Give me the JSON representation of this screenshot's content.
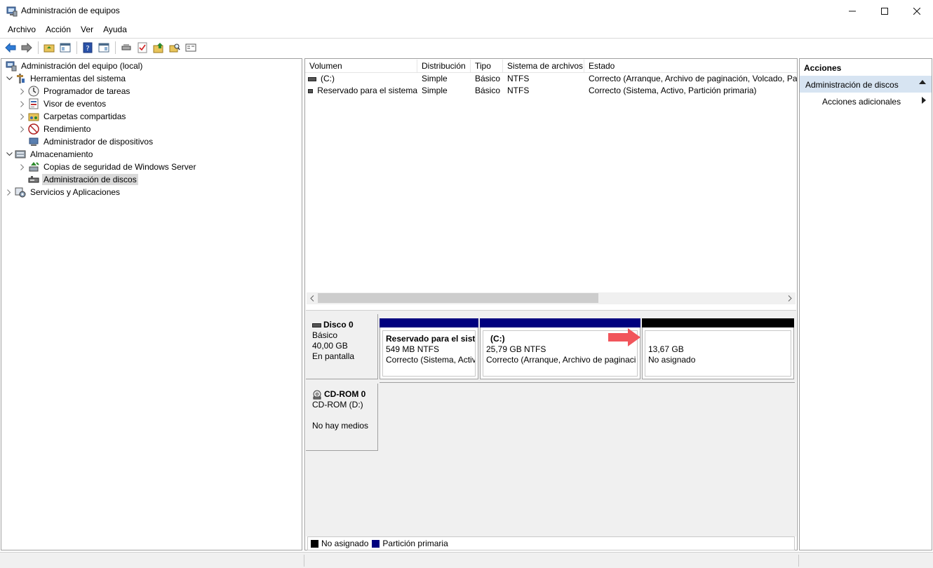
{
  "window": {
    "title": "Administración de equipos"
  },
  "menu": [
    "Archivo",
    "Acción",
    "Ver",
    "Ayuda"
  ],
  "tree": {
    "root": "Administración del equipo (local)",
    "system_tools": "Herramientas del sistema",
    "task_scheduler": "Programador de tareas",
    "event_viewer": "Visor de eventos",
    "shared_folders": "Carpetas compartidas",
    "performance": "Rendimiento",
    "device_manager": "Administrador de dispositivos",
    "storage": "Almacenamiento",
    "backup": "Copias de seguridad de Windows Server",
    "disk_management": "Administración de discos",
    "services_apps": "Servicios y Aplicaciones"
  },
  "volumes": {
    "headers": [
      "Volumen",
      "Distribución",
      "Tipo",
      "Sistema de archivos",
      "Estado"
    ],
    "rows": [
      [
        "(C:)",
        "Simple",
        "Básico",
        "NTFS",
        "Correcto (Arranque, Archivo de paginación, Volcado, Pa"
      ],
      [
        "Reservado para el sistema",
        "Simple",
        "Básico",
        "NTFS",
        "Correcto (Sistema, Activo, Partición primaria)"
      ]
    ]
  },
  "disks": {
    "disk0": {
      "name": "Disco 0",
      "type": "Básico",
      "size": "40,00 GB",
      "status": "En pantalla"
    },
    "part_reserved": {
      "name": "Reservado para el siste",
      "size": "549 MB NTFS",
      "status": "Correcto (Sistema, Activ"
    },
    "part_c": {
      "name": "(C:)",
      "size": "25,79 GB NTFS",
      "status": "Correcto (Arranque, Archivo de paginaci"
    },
    "part_unalloc": {
      "size": "13,67 GB",
      "status": "No asignado"
    },
    "cdrom": {
      "name": "CD-ROM 0",
      "type": "CD-ROM (D:)",
      "status": "No hay medios"
    }
  },
  "legend": {
    "unallocated": "No asignado",
    "primary": "Partición primaria"
  },
  "colors": {
    "primary_partition": "#00007f",
    "unallocated": "#000000",
    "arrow": "#f1555b",
    "actions_section": "#d7e4f2"
  },
  "actions": {
    "title": "Acciones",
    "section": "Administración de discos",
    "more": "Acciones adicionales"
  }
}
